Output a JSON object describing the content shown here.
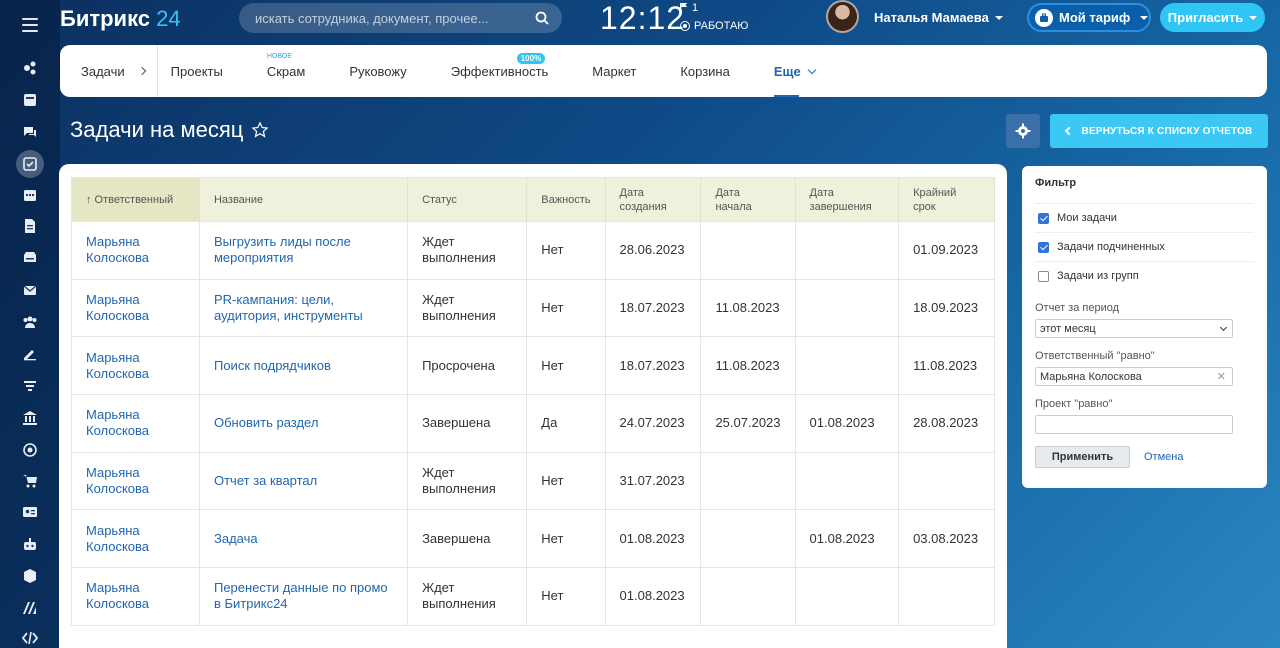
{
  "header": {
    "logo_main": "Битрикс",
    "logo_num": "24",
    "search_placeholder": "искать сотрудника, документ, прочее...",
    "clock": "12:12",
    "flag_count": "1",
    "work_status": "РАБОТАЮ",
    "user_name": "Наталья Мамаева",
    "tariff_label": "Мой тариф",
    "invite_label": "Пригласить"
  },
  "nav": {
    "first": "Задачи",
    "items": [
      "Проекты",
      "Скрам",
      "Руковожу",
      "Эффективность",
      "Маркет",
      "Корзина",
      "Еще"
    ],
    "badge_new": "НОВОЕ",
    "badge_pct": "100%"
  },
  "page": {
    "title": "Задачи на месяц",
    "back_label": "ВЕРНУТЬСЯ К СПИСКУ ОТЧЕТОВ"
  },
  "table": {
    "headers": [
      "↑ Ответственный",
      "Название",
      "Статус",
      "Важность",
      "Дата\nсоздания",
      "Дата\nначала",
      "Дата\nзавершения",
      "Крайний\nсрок"
    ],
    "rows": [
      [
        "Марьяна Колоскова",
        "Выгрузить лиды после мероприятия",
        "Ждет выполнения",
        "Нет",
        "28.06.2023",
        "",
        "",
        "01.09.2023"
      ],
      [
        "Марьяна Колоскова",
        "PR-кампания: цели, аудитория, инструменты",
        "Ждет выполнения",
        "Нет",
        "18.07.2023",
        "11.08.2023",
        "",
        "18.09.2023"
      ],
      [
        "Марьяна Колоскова",
        "Поиск подрядчиков",
        "Просрочена",
        "Нет",
        "18.07.2023",
        "11.08.2023",
        "",
        "11.08.2023"
      ],
      [
        "Марьяна Колоскова",
        "Обновить раздел",
        "Завершена",
        "Да",
        "24.07.2023",
        "25.07.2023",
        "01.08.2023",
        "28.08.2023"
      ],
      [
        "Марьяна Колоскова",
        "Отчет за квартал",
        "Ждет выполнения",
        "Нет",
        "31.07.2023",
        "",
        "",
        ""
      ],
      [
        "Марьяна Колоскова",
        "Задача",
        "Завершена",
        "Нет",
        "01.08.2023",
        "",
        "01.08.2023",
        "03.08.2023"
      ],
      [
        "Марьяна Колоскова",
        "Перенести данные по промо в Битрикс24",
        "Ждет выполнения",
        "Нет",
        "01.08.2023",
        "",
        "",
        ""
      ]
    ]
  },
  "filter": {
    "title": "Фильтр",
    "checks": [
      {
        "label": "Мои задачи",
        "checked": true
      },
      {
        "label": "Задачи подчиненных",
        "checked": true
      },
      {
        "label": "Задачи из групп",
        "checked": false
      }
    ],
    "period_label": "Отчет за период",
    "period_value": "этот месяц",
    "resp_label": "Ответственный \"равно\"",
    "resp_value": "Марьяна Колоскова",
    "project_label": "Проект \"равно\"",
    "project_value": "",
    "apply_label": "Применить",
    "cancel_label": "Отмена"
  },
  "rail_icons": [
    "menu-icon",
    "activity-icon",
    "news-icon",
    "chat-icon",
    "tasks-icon",
    "calendar-icon",
    "docs-icon",
    "drive-icon",
    "mail-icon",
    "groups-icon",
    "sign-icon",
    "filter-icon",
    "bank-icon",
    "target-icon",
    "cart-icon",
    "contacts-icon",
    "robot-icon",
    "box-icon",
    "marta-icon",
    "code-icon"
  ]
}
